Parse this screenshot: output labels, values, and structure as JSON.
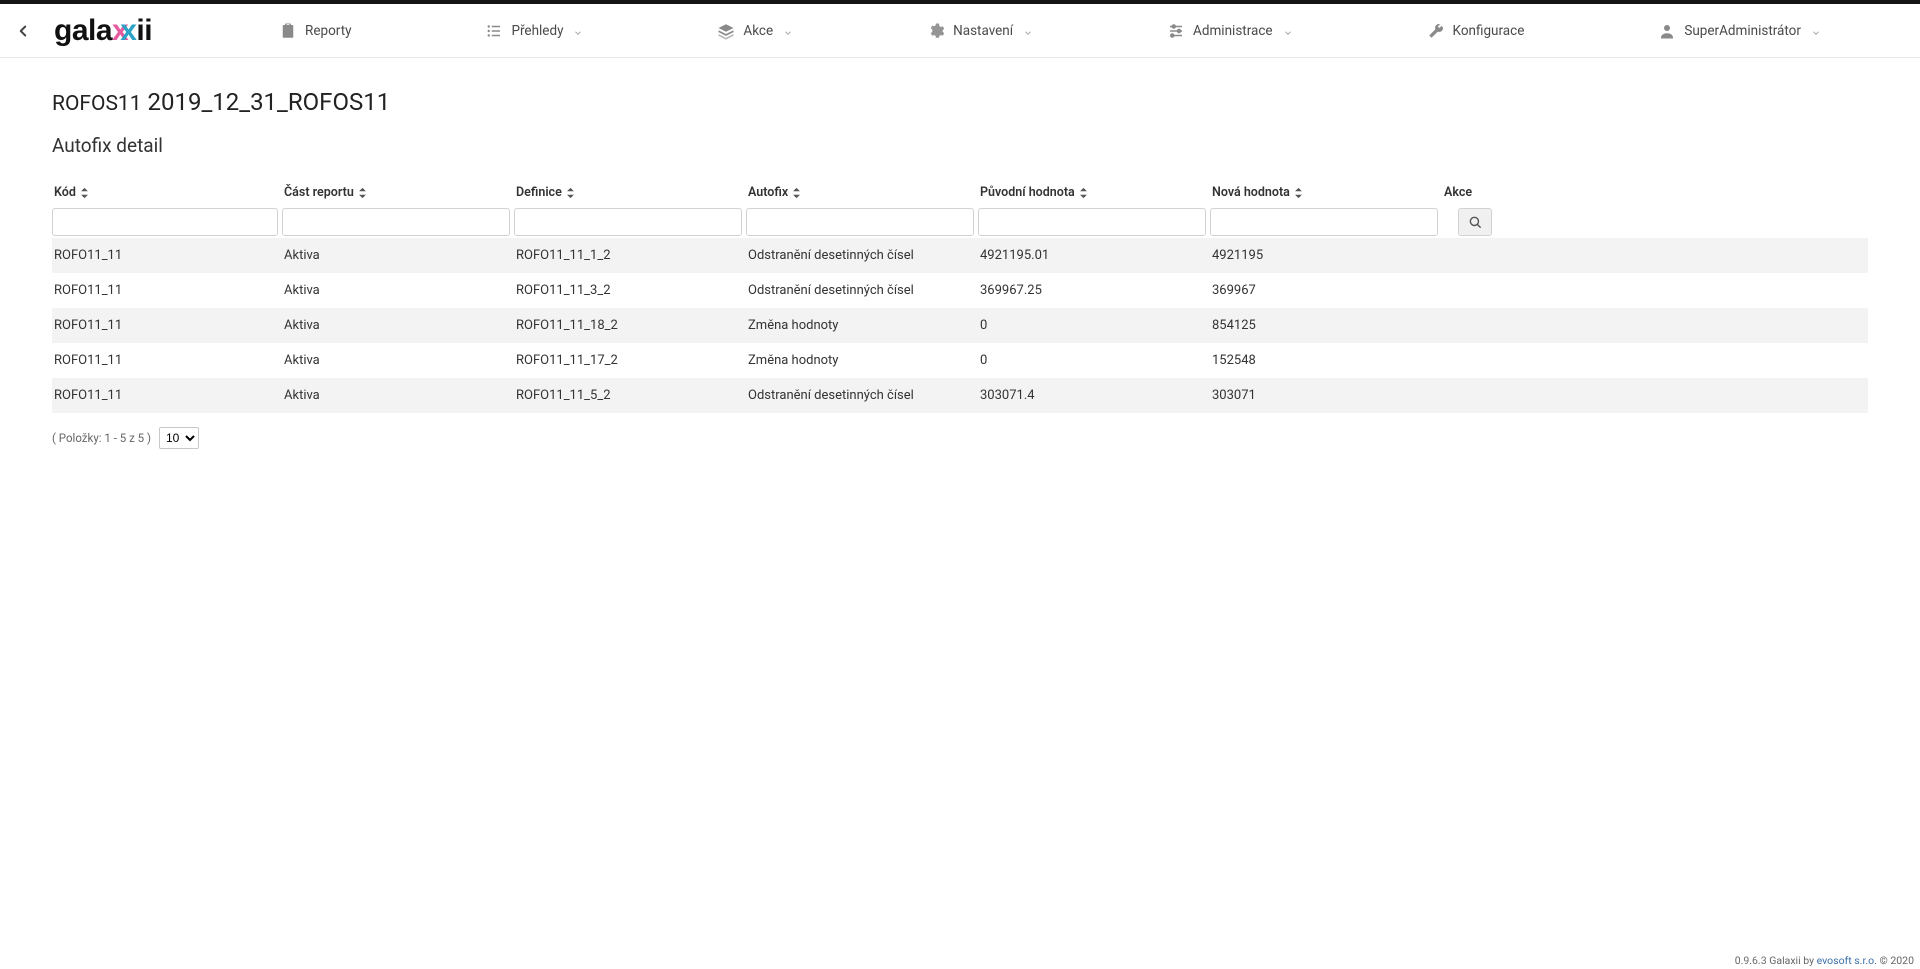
{
  "nav": {
    "items": [
      {
        "label": "Reporty",
        "icon": "clipboard",
        "dropdown": false
      },
      {
        "label": "Přehledy",
        "icon": "list",
        "dropdown": true
      },
      {
        "label": "Akce",
        "icon": "layers",
        "dropdown": true
      },
      {
        "label": "Nastavení",
        "icon": "gear",
        "dropdown": true
      },
      {
        "label": "Administrace",
        "icon": "sliders",
        "dropdown": true
      },
      {
        "label": "Konfigurace",
        "icon": "wrench",
        "dropdown": false
      },
      {
        "label": "SuperAdministrátor",
        "icon": "user",
        "dropdown": true
      }
    ]
  },
  "page": {
    "title_prefix": "ROFOS11",
    "title": "2019_12_31_ROFOS11",
    "subtitle": "Autofix detail"
  },
  "table": {
    "headers": {
      "code": "Kód",
      "part": "Část reportu",
      "def": "Definice",
      "autofix": "Autofix",
      "orig": "Původní hodnota",
      "newv": "Nová hodnota",
      "actions": "Akce"
    },
    "rows": [
      {
        "code": "ROFO11_11",
        "part": "Aktiva",
        "def": "ROFO11_11_1_2",
        "autofix": "Odstranění desetinných čísel",
        "orig": "4921195.01",
        "newv": "4921195"
      },
      {
        "code": "ROFO11_11",
        "part": "Aktiva",
        "def": "ROFO11_11_3_2",
        "autofix": "Odstranění desetinných čísel",
        "orig": "369967.25",
        "newv": "369967"
      },
      {
        "code": "ROFO11_11",
        "part": "Aktiva",
        "def": "ROFO11_11_18_2",
        "autofix": "Změna hodnoty",
        "orig": "0",
        "newv": "854125"
      },
      {
        "code": "ROFO11_11",
        "part": "Aktiva",
        "def": "ROFO11_11_17_2",
        "autofix": "Změna hodnoty",
        "orig": "0",
        "newv": "152548"
      },
      {
        "code": "ROFO11_11",
        "part": "Aktiva",
        "def": "ROFO11_11_5_2",
        "autofix": "Odstranění desetinných čísel",
        "orig": "303071.4",
        "newv": "303071"
      }
    ]
  },
  "pager": {
    "summary": "( Položky: 1 - 5 z 5 )",
    "page_size": "10"
  },
  "footer": {
    "version": "0.9.6.3 Galaxii by ",
    "link": "evosoft s.r.o.",
    "copyright": " © 2020"
  }
}
